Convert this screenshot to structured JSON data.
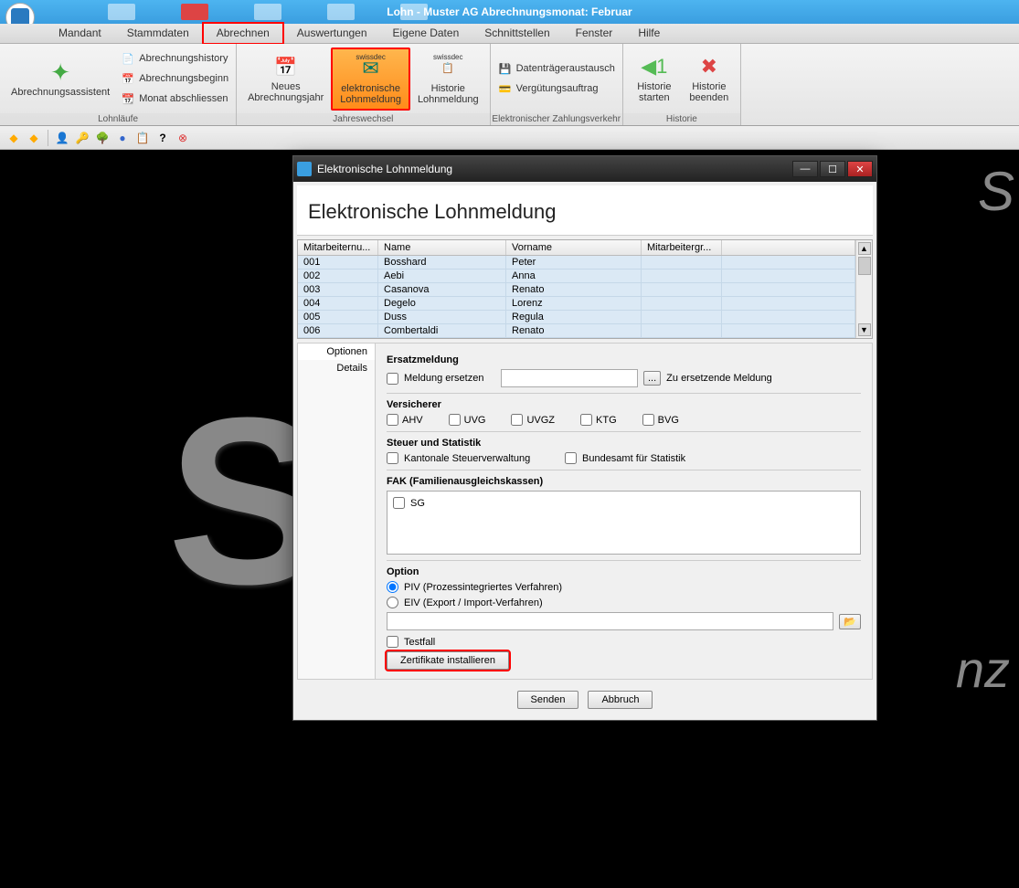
{
  "app": {
    "title": "Lohn - Muster AG   Abrechnungsmonat: Februar"
  },
  "menu": {
    "items": [
      "Mandant",
      "Stammdaten",
      "Abrechnen",
      "Auswertungen",
      "Eigene Daten",
      "Schnittstellen",
      "Fenster",
      "Hilfe"
    ],
    "highlighted": "Abrechnen"
  },
  "ribbon": {
    "groups": [
      {
        "label": "Lohnläufe",
        "buttons": [
          {
            "type": "large",
            "label": "Abrechnungsassistent",
            "icon": "magic"
          },
          {
            "type": "col",
            "items": [
              {
                "label": "Abrechnungshistory",
                "icon": "hist"
              },
              {
                "label": "Abrechnungsbeginn",
                "icon": "cal"
              },
              {
                "label": "Monat abschliessen",
                "icon": "lock"
              }
            ]
          }
        ]
      },
      {
        "label": "Jahreswechsel",
        "buttons": [
          {
            "type": "large",
            "label": "Neues\nAbrechnungsjahr",
            "icon": "cal31"
          },
          {
            "type": "large",
            "label": "elektronische\nLohnmeldung",
            "icon": "swissdec-mail",
            "highlighted": true,
            "badge": "swissdec"
          },
          {
            "type": "large",
            "label": "Historie\nLohnmeldung",
            "icon": "swissdec-hist",
            "badge": "swissdec"
          }
        ]
      },
      {
        "label": "Elektronischer Zahlungsverkehr",
        "buttons": [
          {
            "type": "col",
            "items": [
              {
                "label": "Datenträgeraustausch",
                "icon": "disk"
              },
              {
                "label": "Vergütungsauftrag",
                "icon": "pay"
              }
            ]
          }
        ]
      },
      {
        "label": "Historie",
        "buttons": [
          {
            "type": "large",
            "label": "Historie\nstarten",
            "icon": "hist-start"
          },
          {
            "type": "large",
            "label": "Historie\nbeenden",
            "icon": "hist-stop"
          }
        ]
      }
    ]
  },
  "dialog": {
    "title": "Elektronische Lohnmeldung",
    "heading": "Elektronische Lohnmeldung",
    "table": {
      "columns": [
        "Mitarbeiternu...",
        "Name",
        "Vorname",
        "Mitarbeitergr..."
      ],
      "rows": [
        {
          "num": "001",
          "name": "Bosshard",
          "vorname": "Peter",
          "gr": ""
        },
        {
          "num": "002",
          "name": "Aebi",
          "vorname": "Anna",
          "gr": ""
        },
        {
          "num": "003",
          "name": "Casanova",
          "vorname": "Renato",
          "gr": ""
        },
        {
          "num": "004",
          "name": "Degelo",
          "vorname": "Lorenz",
          "gr": ""
        },
        {
          "num": "005",
          "name": "Duss",
          "vorname": "Regula",
          "gr": ""
        },
        {
          "num": "006",
          "name": "Combertaldi",
          "vorname": "Renato",
          "gr": ""
        }
      ]
    },
    "tabs": [
      "Optionen",
      "Details"
    ],
    "activeTab": "Optionen",
    "form": {
      "ersatz": {
        "title": "Ersatzmeldung",
        "chk": "Meldung ersetzen",
        "rightLabel": "Zu ersetzende Meldung"
      },
      "versicherer": {
        "title": "Versicherer",
        "items": [
          "AHV",
          "UVG",
          "UVGZ",
          "KTG",
          "BVG"
        ]
      },
      "steuer": {
        "title": "Steuer und Statistik",
        "chk1": "Kantonale Steuerverwaltung",
        "chk2": "Bundesamt für Statistik"
      },
      "fak": {
        "title": "FAK (Familienausgleichskassen)",
        "item": "SG"
      },
      "option": {
        "title": "Option",
        "piv": "PIV (Prozessintegriertes Verfahren)",
        "eiv": "EIV (Export / Import-Verfahren)",
        "testfall": "Testfall",
        "btn": "Zertifikate installieren"
      }
    },
    "footer": {
      "send": "Senden",
      "cancel": "Abbruch"
    }
  }
}
